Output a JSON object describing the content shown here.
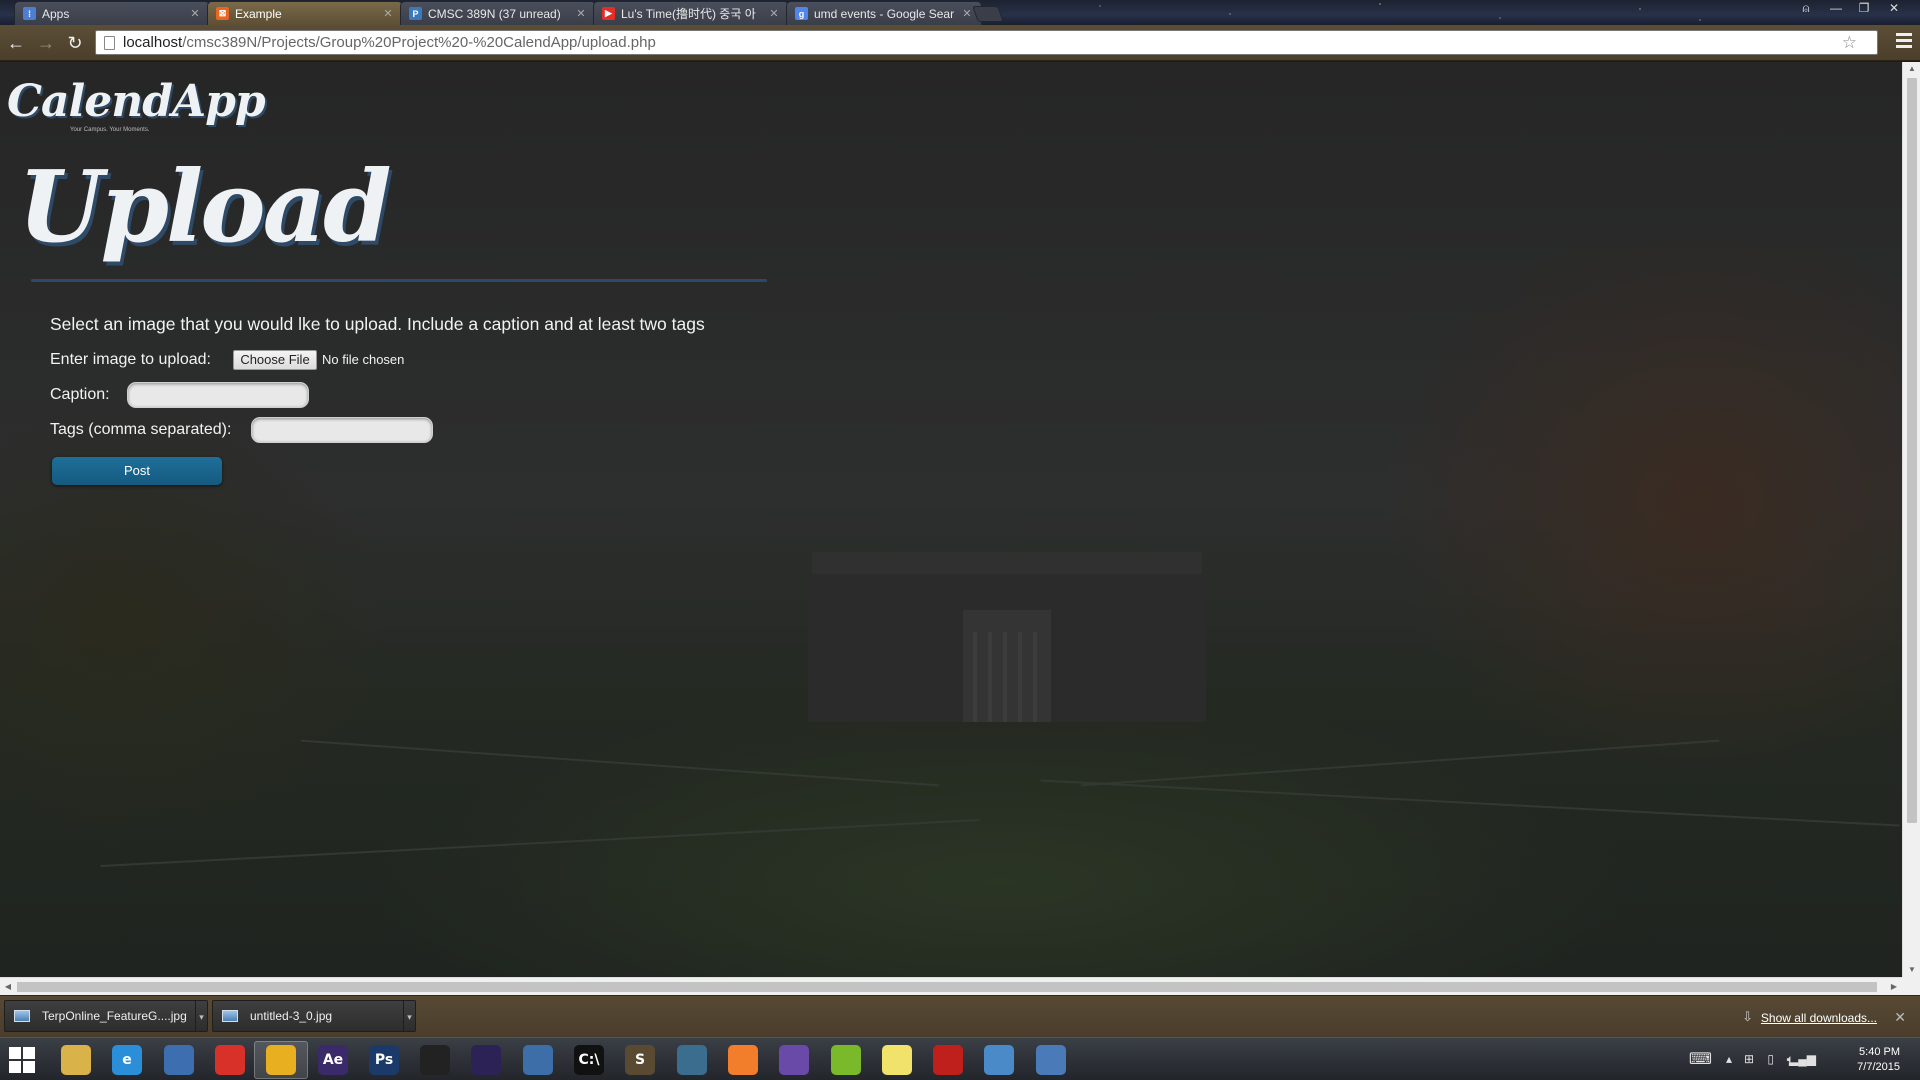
{
  "browser": {
    "tabs": [
      {
        "title": "Apps",
        "favicon": "apps-icon",
        "active": false
      },
      {
        "title": "Example",
        "favicon": "html-icon",
        "active": true
      },
      {
        "title": "CMSC 389N (37 unread)",
        "favicon": "piazza-icon",
        "active": false
      },
      {
        "title": "Lu's Time(撸时代) 중국 아",
        "favicon": "youtube-icon",
        "active": false
      },
      {
        "title": "umd events - Google Sear",
        "favicon": "google-icon",
        "active": false
      }
    ],
    "address": {
      "host": "localhost",
      "path": "/cmsc389N/Projects/Group%20Project%20-%20CalendApp/upload.php"
    }
  },
  "page": {
    "logo": "CalendApp",
    "tagline": "Your Campus. Your Moments.",
    "heading": "Upload",
    "instructions": "Select an image that you would lke to upload. Include a caption and at least two tags",
    "form": {
      "image_label": "Enter image to upload:",
      "choose_file_label": "Choose File",
      "no_file_text": "No file chosen",
      "caption_label": "Caption:",
      "caption_value": "",
      "tags_label": "Tags (comma separated):",
      "tags_value": "",
      "post_label": "Post"
    }
  },
  "downloads": {
    "items": [
      {
        "name": "TerpOnline_FeatureG....jpg"
      },
      {
        "name": "untitled-3_0.jpg"
      }
    ],
    "show_all": "Show all downloads..."
  },
  "taskbar": {
    "apps": [
      {
        "name": "file-explorer-icon",
        "glyph": "",
        "color": "#d9b24a",
        "running": false
      },
      {
        "name": "internet-explorer-icon",
        "glyph": "e",
        "color": "#2a8fd8",
        "running": false
      },
      {
        "name": "remote-desktop-icon",
        "glyph": "",
        "color": "#3d6fb0",
        "running": false
      },
      {
        "name": "cloud-app-icon",
        "glyph": "",
        "color": "#d8312a",
        "running": false
      },
      {
        "name": "chrome-icon",
        "glyph": "",
        "color": "#e8b020",
        "running": true
      },
      {
        "name": "after-effects-icon",
        "glyph": "Ae",
        "color": "#3b2a6a",
        "running": false
      },
      {
        "name": "photoshop-icon",
        "glyph": "Ps",
        "color": "#1b3a6a",
        "running": false
      },
      {
        "name": "film-editor-icon",
        "glyph": "",
        "color": "#222222",
        "running": false
      },
      {
        "name": "eclipse-icon",
        "glyph": "",
        "color": "#2c2255",
        "running": false
      },
      {
        "name": "python-icon",
        "glyph": "",
        "color": "#3e6ea8",
        "running": false
      },
      {
        "name": "command-prompt-icon",
        "glyph": "C:\\",
        "color": "#111111",
        "running": false
      },
      {
        "name": "sublime-text-icon",
        "glyph": "S",
        "color": "#5a4a32",
        "running": false
      },
      {
        "name": "mysql-workbench-icon",
        "glyph": "",
        "color": "#3b6d8e",
        "running": false
      },
      {
        "name": "xampp-icon",
        "glyph": "",
        "color": "#f27d2a",
        "running": false
      },
      {
        "name": "github-icon",
        "glyph": "",
        "color": "#6a4aa8",
        "running": false
      },
      {
        "name": "spotify-icon",
        "glyph": "",
        "color": "#7ab929",
        "running": false
      },
      {
        "name": "sticky-notes-icon",
        "glyph": "",
        "color": "#f0e26a",
        "running": false
      },
      {
        "name": "acrobat-icon",
        "glyph": "",
        "color": "#c0201c",
        "running": false
      },
      {
        "name": "paint-icon",
        "glyph": "",
        "color": "#4a8ac8",
        "running": false
      },
      {
        "name": "photo-viewer-icon",
        "glyph": "",
        "color": "#4a7ab8",
        "running": false
      }
    ],
    "time": "5:40 PM",
    "date": "7/7/2015"
  }
}
